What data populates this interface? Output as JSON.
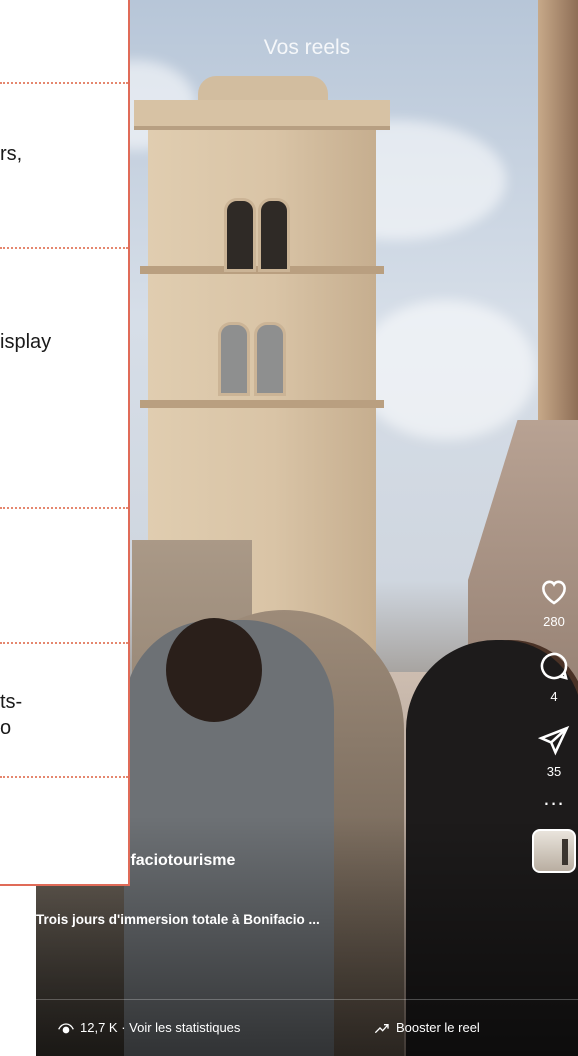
{
  "reel": {
    "title": "Vos reels",
    "username": "ifaciotourisme",
    "caption": "Trois jours d'immersion totale à Bonifacio ...",
    "likes": "280",
    "comments": "4",
    "shares": "35",
    "more_label": "...",
    "stats_label": "12,7 K · Voir les statistiques",
    "boost_label": "Booster le reel"
  },
  "panel": {
    "fragment_1": "rs,",
    "fragment_2": "isplay",
    "fragment_3a": "ts-",
    "fragment_3b": "o"
  },
  "colors": {
    "panel_border": "#e06b58",
    "divider": "#e5876f"
  },
  "icons": [
    "heart-icon",
    "comment-icon",
    "share-icon",
    "more-icon",
    "eye-icon",
    "trend-icon"
  ]
}
